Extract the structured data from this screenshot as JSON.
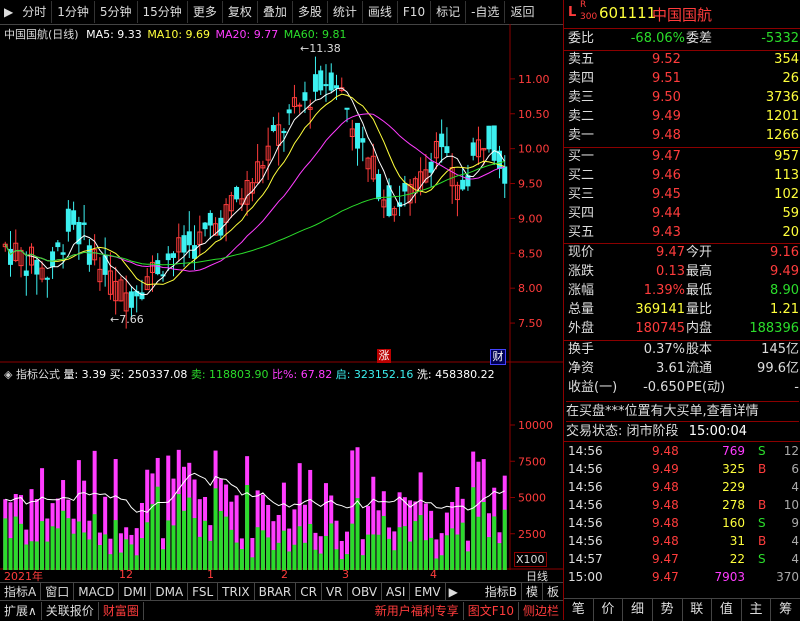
{
  "toolbar": {
    "items": [
      "分时",
      "1分钟",
      "5分钟",
      "15分钟",
      "更多",
      "复权",
      "叠加",
      "多股",
      "统计",
      "画线",
      "F10",
      "标记",
      "-自选",
      "返回"
    ]
  },
  "stock_header": {
    "badge_l": "L",
    "badge_r": "R",
    "badge_num": "300",
    "code": "601111",
    "name": "中国国航"
  },
  "chart_title": {
    "name": "中国国航(日线)",
    "ma5": "MA5: 9.33",
    "ma10": "MA10: 9.69",
    "ma20": "MA20: 9.77",
    "ma60": "MA60: 9.81"
  },
  "price_axis": [
    "11.00",
    "10.50",
    "10.00",
    "9.50",
    "9.00",
    "8.50",
    "8.00",
    "7.50"
  ],
  "annotations": {
    "high": "11.38",
    "low": "7.66",
    "zhang": "涨",
    "cai": "财"
  },
  "indicator_title": {
    "label": "指标公式",
    "liang": "量: 3.39",
    "mai": "买: 250337.08",
    "sell": "卖: 118803.90",
    "bi": "比%: 67.82",
    "qi": "启: 323152.16",
    "xi": "洗: 458380.22"
  },
  "volume_axis": [
    "10000",
    "7500",
    "5000",
    "2500"
  ],
  "volume_unit": "X100",
  "date_axis": [
    "2021年",
    "12",
    "1",
    "2",
    "3",
    "4"
  ],
  "period_label": "日线",
  "indicator_tabs": [
    "指标A",
    "窗口",
    "MACD",
    "DMI",
    "DMA",
    "FSL",
    "TRIX",
    "BRAR",
    "CR",
    "VR",
    "OBV",
    "ASI",
    "EMV"
  ],
  "indicator_tabs_right": [
    "指标B",
    "模",
    "板"
  ],
  "status_bar": {
    "expand": "扩展∧",
    "quote": "关联报价",
    "fortune": "财富圈",
    "promo": "新用户福利专享",
    "f10": "图文F10",
    "sidebar": "侧边栏"
  },
  "right_tabs": [
    "笔",
    "价",
    "细",
    "势",
    "联",
    "值",
    "主",
    "筹"
  ],
  "weibi": {
    "label": "委比",
    "value": "-68.06%",
    "label2": "委差",
    "value2": "-5332"
  },
  "asks": [
    {
      "label": "卖五",
      "price": "9.52",
      "vol": "354"
    },
    {
      "label": "卖四",
      "price": "9.51",
      "vol": "26"
    },
    {
      "label": "卖三",
      "price": "9.50",
      "vol": "3736"
    },
    {
      "label": "卖二",
      "price": "9.49",
      "vol": "1201"
    },
    {
      "label": "卖一",
      "price": "9.48",
      "vol": "1266"
    }
  ],
  "bids": [
    {
      "label": "买一",
      "price": "9.47",
      "vol": "957"
    },
    {
      "label": "买二",
      "price": "9.46",
      "vol": "113"
    },
    {
      "label": "买三",
      "price": "9.45",
      "vol": "102"
    },
    {
      "label": "买四",
      "price": "9.44",
      "vol": "59"
    },
    {
      "label": "买五",
      "price": "9.43",
      "vol": "20"
    }
  ],
  "quote": [
    {
      "l1": "现价",
      "v1": "9.47",
      "l2": "今开",
      "v2": "9.16"
    },
    {
      "l1": "涨跌",
      "v1": "0.13",
      "l2": "最高",
      "v2": "9.49"
    },
    {
      "l1": "涨幅",
      "v1": "1.39%",
      "l2": "最低",
      "v2": "8.90"
    },
    {
      "l1": "总量",
      "v1": "369141",
      "l2": "量比",
      "v2": "1.21"
    },
    {
      "l1": "外盘",
      "v1": "180745",
      "l2": "内盘",
      "v2": "188396"
    }
  ],
  "fundamentals": [
    {
      "l1": "换手",
      "v1": "0.37%",
      "l2": "股本",
      "v2": "145亿"
    },
    {
      "l1": "净资",
      "v1": "3.61",
      "l2": "流通",
      "v2": "99.6亿"
    },
    {
      "l1": "收益(一)",
      "v1": "-0.650",
      "l2": "PE(动)",
      "v2": "-"
    }
  ],
  "notice": "在买盘***位置有大买单,查看详情",
  "trade_state": {
    "label": "交易状态:",
    "state": "闭市阶段",
    "time": "15:00:04"
  },
  "ticks": [
    {
      "time": "14:56",
      "price": "9.48",
      "vol": "769",
      "bs": "S",
      "n": "12"
    },
    {
      "time": "14:56",
      "price": "9.49",
      "vol": "325",
      "bs": "B",
      "n": "6"
    },
    {
      "time": "14:56",
      "price": "9.48",
      "vol": "229",
      "bs": "",
      "n": "4"
    },
    {
      "time": "14:56",
      "price": "9.48",
      "vol": "278",
      "bs": "B",
      "n": "10"
    },
    {
      "time": "14:56",
      "price": "9.48",
      "vol": "160",
      "bs": "S",
      "n": "9"
    },
    {
      "time": "14:56",
      "price": "9.48",
      "vol": "31",
      "bs": "B",
      "n": "4"
    },
    {
      "time": "14:57",
      "price": "9.47",
      "vol": "22",
      "bs": "S",
      "n": "4"
    },
    {
      "time": "15:00",
      "price": "9.47",
      "vol": "7903",
      "bs": "",
      "n": "370"
    }
  ],
  "colors": {
    "up": "#ff3c3c",
    "down": "#2bdc2b",
    "ma5": "#ffffff",
    "ma10": "#ffff3c",
    "ma20": "#ff3cff",
    "ma60": "#2bdc2b",
    "grid": "#8b0000"
  }
}
